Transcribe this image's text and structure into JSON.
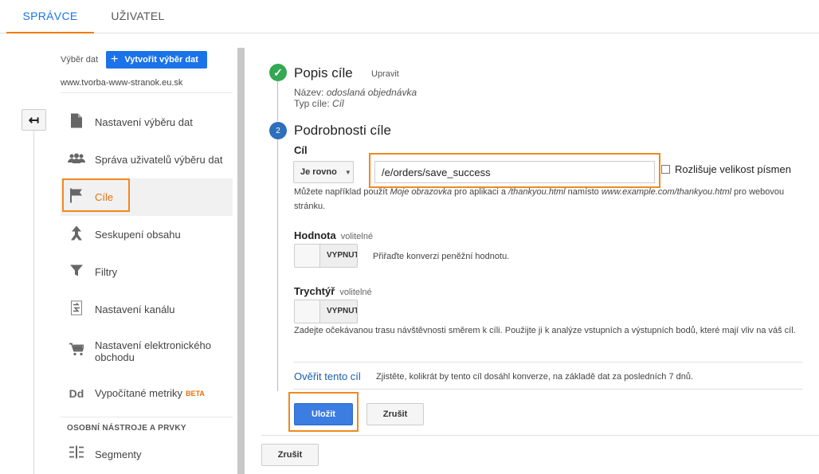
{
  "tabs": {
    "admin": "SPRÁVCE",
    "user": "UŽIVATEL"
  },
  "sidebar": {
    "view_label": "Výběr dat",
    "create_button": "Vytvořit výběr dat",
    "site": "www.tvorba-www-stranok.eu.sk",
    "items": [
      {
        "label": "Nastavení výběru dat",
        "icon": "document-icon"
      },
      {
        "label": "Správa uživatelů výběru dat",
        "icon": "users-icon"
      },
      {
        "label": "Cíle",
        "icon": "flag-icon",
        "active": true
      },
      {
        "label": "Seskupení obsahu",
        "icon": "grouping-icon"
      },
      {
        "label": "Filtry",
        "icon": "filter-icon"
      },
      {
        "label": "Nastavení kanálu",
        "icon": "channel-icon"
      },
      {
        "label": "Nastavení elektronického obchodu",
        "icon": "cart-icon"
      },
      {
        "label": "Vypočítané metriky",
        "icon": "dd-icon",
        "badge": "BETA"
      }
    ],
    "section_label": "OSOBNÍ NÁSTROJE A PRVKY",
    "segments_label": "Segmenty"
  },
  "goal": {
    "description_title": "Popis cíle",
    "edit_link": "Upravit",
    "name_label": "Název:",
    "name_value": "odoslaná objednávka",
    "type_label": "Typ cíle:",
    "type_value": "Cíl",
    "step2_number": "2",
    "details_title": "Podrobnosti cíle",
    "destination_label": "Cíl",
    "match_type": "Je rovno",
    "destination_value": "/e/orders/save_success",
    "case_sensitive_label": "Rozlišuje velikost písmen",
    "hint_prefix": "Můžete například použít ",
    "hint_example1": "Moje obrazovka",
    "hint_mid1": " pro aplikaci a ",
    "hint_example2": "/thankyou.html",
    "hint_mid2": " namísto ",
    "hint_example3": "www.example.com/thankyou.html",
    "hint_suffix": " pro webovou stránku.",
    "value_label": "Hodnota",
    "value_optional": "volitelné",
    "value_toggle": "VYPNUTO",
    "value_hint": "Přiřaďte konverzi peněžní hodnotu.",
    "funnel_label": "Trychtýř",
    "funnel_optional": "volitelné",
    "funnel_toggle": "VYPNUTO",
    "funnel_hint": "Zadejte očekávanou trasu návštěvnosti směrem k cíli. Použijte ji k analýze vstupních a výstupních bodů, které mají vliv na váš cíl.",
    "verify_link": "Ověřit tento cíl",
    "verify_hint": "Zjistěte, kolikrát by tento cíl dosáhl konverze, na základě dat za posledních 7 dnů.",
    "save_button": "Uložit",
    "cancel_button": "Zrušit",
    "cancel_outer_button": "Zrušit"
  },
  "colors": {
    "accent": "#1a73e8",
    "highlight": "#f0891e",
    "success": "#34a853",
    "step": "#2d6fba"
  }
}
